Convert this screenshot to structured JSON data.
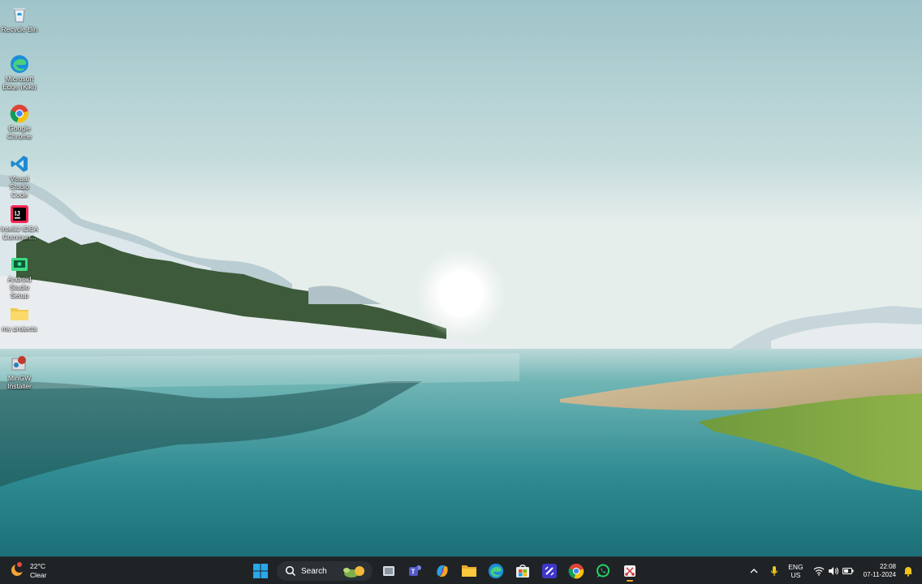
{
  "desktop": {
    "icons": [
      {
        "label": "Recycle Bin",
        "icon": "recycle-bin-icon"
      },
      {
        "label": "Microsoft\nEdge (Kiki)",
        "icon": "edge-icon"
      },
      {
        "label": "Google\nChrome",
        "icon": "chrome-icon"
      },
      {
        "label": "Visual Studio\nCode",
        "icon": "vscode-icon"
      },
      {
        "label": "IntelliJ IDEA\nCommun...",
        "icon": "intellij-icon"
      },
      {
        "label": "Android Studio\nSetup",
        "icon": "android-studio-icon"
      },
      {
        "label": "my projects",
        "icon": "folder-icon"
      },
      {
        "label": "MinGW\nInstaller",
        "icon": "mingw-installer-icon"
      }
    ]
  },
  "taskbar": {
    "weather": {
      "temp": "22°C",
      "condition": "Clear",
      "icon": "weather-moon-icon"
    },
    "search": {
      "label": "Search"
    },
    "pinned": [
      {
        "name": "Task View",
        "icon": "task-view-icon"
      },
      {
        "name": "Microsoft Teams",
        "icon": "teams-icon"
      },
      {
        "name": "Copilot",
        "icon": "copilot-icon"
      },
      {
        "name": "File Explorer",
        "icon": "file-explorer-icon"
      },
      {
        "name": "Microsoft Edge",
        "icon": "edge-icon"
      },
      {
        "name": "Microsoft Store",
        "icon": "store-icon"
      },
      {
        "name": "Visual Studio Code",
        "icon": "code-icon"
      },
      {
        "name": "Google Chrome",
        "icon": "chrome-icon"
      },
      {
        "name": "WhatsApp",
        "icon": "whatsapp-icon"
      },
      {
        "name": "Snipping Tool",
        "icon": "snipping-tool-icon"
      }
    ],
    "tray": {
      "lang_line1": "ENG",
      "lang_line2": "US",
      "time": "22:08",
      "date": "07-11-2024"
    }
  },
  "colors": {
    "taskbar_bg": "#1f2326",
    "accent": "#0078d4",
    "active_indicator": "#f5a623"
  }
}
